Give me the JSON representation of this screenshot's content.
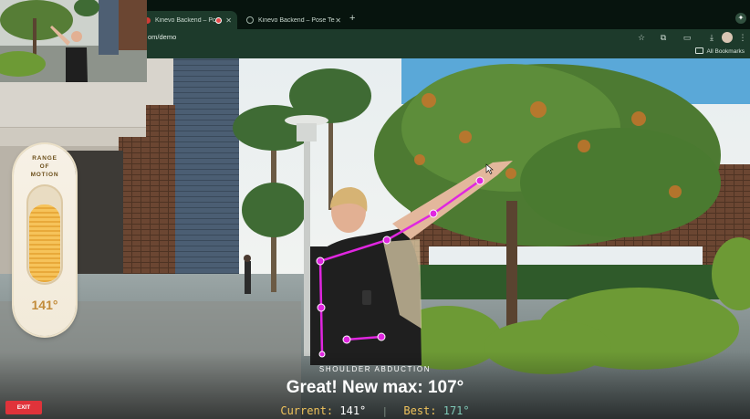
{
  "browser": {
    "tabs": [
      {
        "label": "Kinevo Backend – Pose S",
        "active": true
      },
      {
        "label": "Kinevo Backend – Pose Test",
        "active": false
      }
    ],
    "new_tab_symbol": "+",
    "url": "om/demo",
    "bookmarks_label": "All Bookmarks"
  },
  "rom_gauge": {
    "title_line1": "RANGE",
    "title_line2": "OF",
    "title_line3": "MOTION",
    "value": "141°",
    "fill_fraction": 0.82
  },
  "hud": {
    "exercise": "SHOULDER ABDUCTION",
    "message": "Great! New max: 107°",
    "current_label": "Current:",
    "current_value": "141°",
    "divider": "|",
    "best_label": "Best:",
    "best_value": "171°"
  },
  "exit_label": "EXIT",
  "colors": {
    "skeleton": "#e026e0",
    "gauge_fill": "#f6c35a",
    "exit": "#e0333a",
    "best": "#7ec7b6",
    "label": "#f0c35c"
  }
}
